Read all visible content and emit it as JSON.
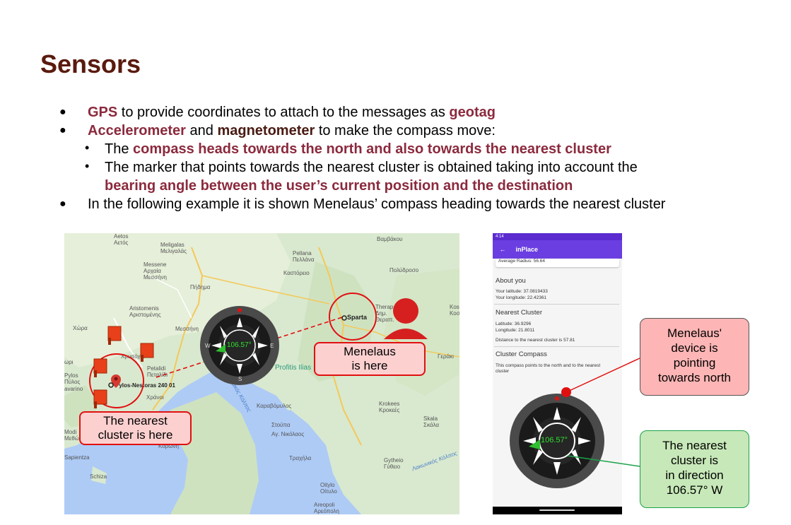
{
  "slide": {
    "title": "Sensors",
    "b1": {
      "p1": "GPS",
      "p2": " to provide coordinates to attach to the messages as ",
      "p3": "geotag"
    },
    "b2": {
      "p1": "Accelerometer",
      "p2": " and ",
      "p3": "magnetometer",
      "p4": " to make the compass move:"
    },
    "b3": {
      "p1": "The ",
      "p2": "compass heads towards the north and also towards the nearest cluster"
    },
    "b4": {
      "p1": "The marker that points towards the nearest cluster is obtained taking into account the",
      "p2": "bearing angle between the user’s current position and the destination"
    },
    "b5": "In the following example it is shown Menelaus’ compass heading towards the nearest cluster"
  },
  "map": {
    "labels": {
      "aetos": "Aetos\nΑετός",
      "meligalas": "Meligalas\nΜελιγαλάς",
      "messene": "Messene\nΑρχαία\nΜεσσήνη",
      "pidima": "Πήδημα",
      "pellana": "Pellana\nΠελλάνα",
      "kastorio": "Καστόρειο",
      "vamvakou": "Βαμβάκου",
      "polydroso": "Πολύδροσο",
      "aristomenis": "Aristomenis\nΑριστομένης",
      "chora": "Χώρα",
      "messini": "Μεσσήνη",
      "chrysochoi": "Χρυσόχοι",
      "petalidi": "Petalidi\nΠεταλίδι",
      "pylos": "Pylos-Nestoras 240 01",
      "chrani": "Χράνοι",
      "profitis": "Profitis Ilias",
      "sparta": "Sparta",
      "therapnes": "Therap.\nΔημ.\nΘεραπ.",
      "koskina": "Kosk.\nΚοσ.",
      "geraki": "Γεράκι",
      "karavomylos": "Καραβόμυλος",
      "krokees": "Krokees\nΚροκεές",
      "skala": "Skala\nΣκάλα",
      "stoupa": "Στούπα",
      "agnikolaos": "Αγ. Νικόλαος",
      "koroni": "Koroni\nΚορώνη",
      "sapientza": "Sapientza",
      "schiza": "Schiza",
      "trachila": "Τραχήλα",
      "gytheio": "Gytheio\nΓύθειο",
      "oitylo": "Oitylo\nΟίτυλο",
      "areopoli": "Areopoli\nΑρεόπολη",
      "lakonikos": "Λακωνικός Κόλπος",
      "messiniakos": "Μεσσηνιακός Κόλπος",
      "modi": "Modi\nΜεθώ",
      "pylos_left": "Pylos\nΠύλος",
      "lavarino": "avarino",
      "pilaki": "ωρι"
    },
    "compass_value": "106.57°",
    "compass_letters": {
      "n": "N",
      "e": "E",
      "s": "S",
      "w": "W"
    },
    "callout_menelaus": "Menelaus\nis here",
    "callout_cluster": "The nearest\ncluster is here"
  },
  "phone": {
    "status_time": "4:14",
    "title": "inPlace",
    "avg_radius": "Average Radius: 56.64",
    "about_title": "About you",
    "latitude": "Your latitude: 37.0819433",
    "longitude": "Your longitude: 22.42361",
    "nearest_title": "Nearest Cluster",
    "n_latitude": "Latitude: 36.9296",
    "n_longitude": "Longitude: 21.8011",
    "distance": "Distance to the nearest cluster is 57.81",
    "compass_title": "Cluster Compass",
    "compass_desc": "This compass points to the north and to the nearest cluster",
    "compass_value": "106.57°"
  },
  "notes": {
    "north": "Menelaus'\ndevice is\npointing\ntowards north",
    "direction": "The nearest\ncluster is\nin direction\n106.57° W"
  },
  "colors": {
    "title": "#5a1a0e",
    "highlight": "#8b2a3d",
    "accent": "#6a3ee0",
    "red": "#e01010",
    "green": "#1aa34a"
  }
}
